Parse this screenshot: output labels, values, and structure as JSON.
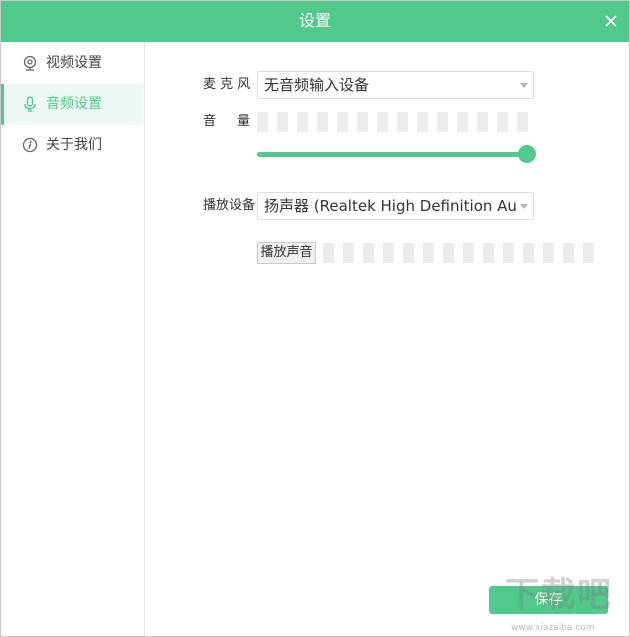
{
  "window": {
    "title": "设置",
    "close_icon": "close-icon"
  },
  "sidebar": {
    "items": [
      {
        "label": "视频设置",
        "icon": "webcam-icon",
        "selected": false
      },
      {
        "label": "音频设置",
        "icon": "microphone-icon",
        "selected": true
      },
      {
        "label": "关于我们",
        "icon": "info-icon",
        "selected": false
      }
    ]
  },
  "audio": {
    "mic_label": "麦 克 风",
    "mic_device": "无音频输入设备",
    "volume_label": "音 量",
    "mic_meter": {
      "segments": 14,
      "active": 0
    },
    "volume_level": 1.0,
    "playback_label": "播放设备",
    "playback_device": "扬声器 (Realtek High Definition Audio",
    "play_sound_button": "播放声音",
    "playback_meter": {
      "segments": 14,
      "active": 0
    }
  },
  "footer": {
    "save_label": "保存"
  },
  "colors": {
    "accent": "#52c98c",
    "meter_idle": "#ececec",
    "selected_bg": "#edf9f2"
  },
  "watermark": {
    "logo": "下载吧",
    "url": "www.xiazaiba.com"
  }
}
